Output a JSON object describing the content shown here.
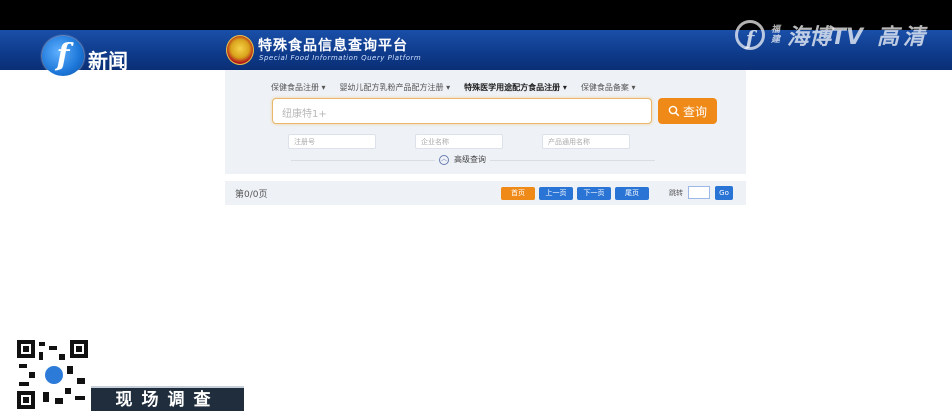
{
  "broadcast": {
    "channel_label": "新闻",
    "channel_logo_letter": "f",
    "watermark": {
      "small": "福建",
      "text": "海博TV",
      "hd": "高清"
    },
    "caption": "现场调查"
  },
  "site": {
    "title": "特殊食品信息查询平台",
    "subtitle": "Special Food Information Query Platform",
    "colors": {
      "header_blue": "#1a4fa8",
      "accent_orange": "#ef8a19",
      "button_blue": "#2a74d6"
    }
  },
  "nav": {
    "items": [
      {
        "label": "保健食品注册 ▾",
        "active": false
      },
      {
        "label": "婴幼儿配方乳粉产品配方注册 ▾",
        "active": false
      },
      {
        "label": "特殊医学用途配方食品注册 ▾",
        "active": true
      },
      {
        "label": "保健食品备案 ▾",
        "active": false
      }
    ]
  },
  "search": {
    "value": "纽康特1+",
    "button_label": "查询",
    "button_icon": "search-icon",
    "fields": [
      {
        "placeholder": "注册号"
      },
      {
        "placeholder": "企业名称"
      },
      {
        "placeholder": "产品通用名称"
      }
    ],
    "advanced_label": "高级查询",
    "advanced_icon": "chevron-up-circle-icon"
  },
  "pagination": {
    "page_text": "第0/0页",
    "first": "首页",
    "prev": "上一页",
    "next": "下一页",
    "last": "尾页",
    "goto_label": "跳转",
    "go": "Go"
  }
}
